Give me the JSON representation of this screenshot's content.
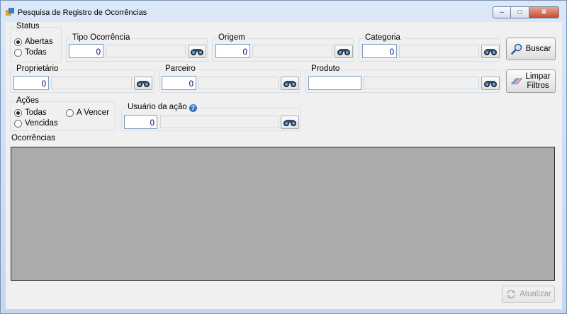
{
  "window": {
    "title": "Pesquisa de Registro de Ocorrências",
    "controls": {
      "minimize": "–",
      "maximize": "□",
      "close": "✕"
    }
  },
  "status": {
    "label": "Status",
    "options": [
      {
        "label": "Abertas",
        "checked": true
      },
      {
        "label": "Todas",
        "checked": false
      }
    ]
  },
  "filters": {
    "tipo_ocorrencia": {
      "label": "Tipo Ocorrência",
      "code": "0",
      "description": ""
    },
    "origem": {
      "label": "Origem",
      "code": "0",
      "description": ""
    },
    "categoria": {
      "label": "Categoria",
      "code": "0",
      "description": ""
    },
    "proprietario": {
      "label": "Proprietário",
      "code": "0",
      "description": ""
    },
    "parceiro": {
      "label": "Parceiro",
      "code": "0",
      "description": ""
    },
    "produto": {
      "label": "Produto",
      "code": "",
      "description": ""
    },
    "usuario_acao": {
      "label": "Usuário da ação",
      "code": "0",
      "description": ""
    }
  },
  "acoes": {
    "label": "Ações",
    "options": [
      {
        "label": "Todas",
        "checked": true
      },
      {
        "label": "A Vencer",
        "checked": false
      },
      {
        "label": "Vencidas",
        "checked": false
      }
    ]
  },
  "buttons": {
    "buscar": "Buscar",
    "limpar_line1": "Limpar",
    "limpar_line2": "Filtros",
    "atualizar": "Atualizar"
  },
  "results": {
    "label": "Ocorrências"
  },
  "icons": {
    "app": "form-icon",
    "lookup": "binoculars-icon",
    "buscar": "magnifier-icon",
    "limpar": "eraser-icon",
    "atualizar": "refresh-icon",
    "help": "question-icon"
  },
  "colors": {
    "grid_background": "#ababab",
    "code_text": "#00008b"
  }
}
